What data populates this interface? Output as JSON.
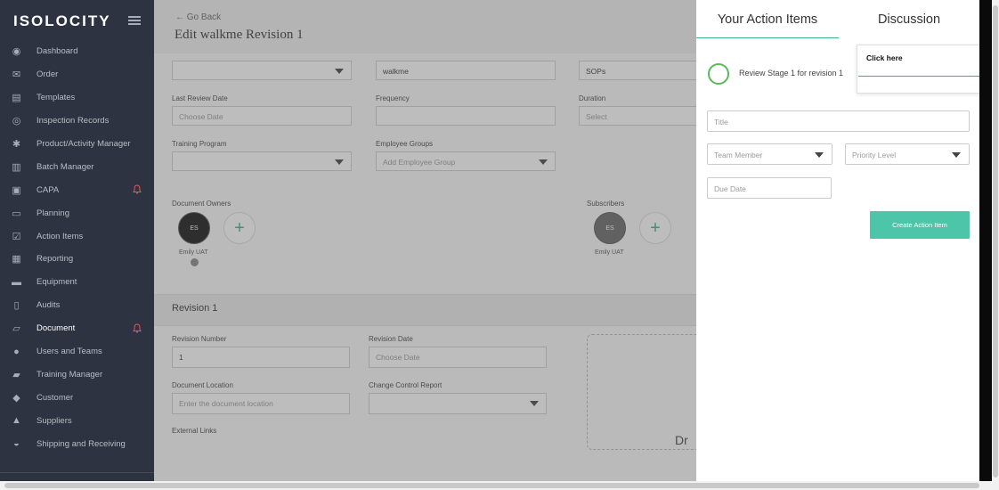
{
  "brand": {
    "name": "ISOLOCITY"
  },
  "sidebar": {
    "items": [
      {
        "label": "Dashboard",
        "icon": "dashboard-icon"
      },
      {
        "label": "Order",
        "icon": "envelope-icon"
      },
      {
        "label": "Templates",
        "icon": "template-icon"
      },
      {
        "label": "Inspection Records",
        "icon": "target-icon"
      },
      {
        "label": "Product/Activity Manager",
        "icon": "gear-icon"
      },
      {
        "label": "Batch Manager",
        "icon": "barcode-icon"
      },
      {
        "label": "CAPA",
        "icon": "briefcase-icon",
        "alert": true
      },
      {
        "label": "Planning",
        "icon": "map-icon"
      },
      {
        "label": "Action Items",
        "icon": "checkbox-icon"
      },
      {
        "label": "Reporting",
        "icon": "report-icon"
      },
      {
        "label": "Equipment",
        "icon": "truck-icon"
      },
      {
        "label": "Audits",
        "icon": "clipboard-icon"
      },
      {
        "label": "Document",
        "icon": "folder-icon",
        "alert": true,
        "active": true
      },
      {
        "label": "Users and Teams",
        "icon": "users-icon"
      },
      {
        "label": "Training Manager",
        "icon": "book-icon"
      },
      {
        "label": "Customer",
        "icon": "tag-icon"
      },
      {
        "label": "Suppliers",
        "icon": "supplier-icon"
      },
      {
        "label": "Shipping and Receiving",
        "icon": "inbox-icon"
      }
    ]
  },
  "main": {
    "go_back": "Go Back",
    "title": "Edit walkme Revision 1",
    "fields": {
      "name_value": "walkme",
      "type_value": "SOPs",
      "last_review_label": "Last Review Date",
      "last_review_placeholder": "Choose Date",
      "frequency_label": "Frequency",
      "duration_label": "Duration",
      "duration_placeholder": "Select",
      "training_label": "Training Program",
      "employee_groups_label": "Employee Groups",
      "employee_groups_placeholder": "Add Employee Group",
      "owners_label": "Document Owners",
      "subscribers_label": "Subscribers",
      "owner_initials": "ES",
      "owner_name": "Emily UAT",
      "subscriber_initials": "ES",
      "subscriber_name": "Emily UAT"
    },
    "revision": {
      "title": "Revision 1",
      "number_label": "Revision Number",
      "number_value": "1",
      "date_label": "Revision Date",
      "date_placeholder": "Choose Date",
      "location_label": "Document Location",
      "location_placeholder": "Enter the document location",
      "ccr_label": "Change Control Report",
      "links_label": "External Links",
      "drop_text": "Dr"
    }
  },
  "panel": {
    "tabs": [
      "Your Action Items",
      "Discussion"
    ],
    "review_item": "Review Stage 1 for revision 1",
    "title_placeholder": "Title",
    "team_member_placeholder": "Team Member",
    "priority_placeholder": "Priority Level",
    "due_date_placeholder": "Due Date",
    "create_button": "Create Action Item"
  },
  "tooltip": {
    "text": "Click here"
  },
  "colors": {
    "sidebar": "#2d3340",
    "accent": "#3bb08f",
    "button": "#4cc5a8",
    "alert": "#e05a5a"
  }
}
